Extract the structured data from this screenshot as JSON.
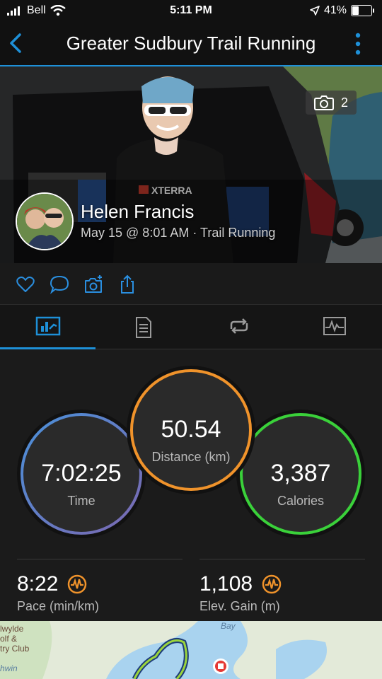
{
  "status_bar": {
    "carrier": "Bell",
    "time": "5:11 PM",
    "battery_percent": "41%",
    "battery_level": 0.41
  },
  "nav": {
    "title": "Greater Sudbury Trail Running"
  },
  "hero": {
    "photo_count": "2",
    "athlete_name": "Helen Francis",
    "activity_meta": "May 15 @ 8:01 AM · Trail Running",
    "shirt_text": "XTERRA"
  },
  "actions": [
    {
      "name": "like",
      "icon": "heart-icon"
    },
    {
      "name": "comment",
      "icon": "comment-icon"
    },
    {
      "name": "add-photo",
      "icon": "camera-plus-icon"
    },
    {
      "name": "share",
      "icon": "share-icon"
    }
  ],
  "tabs": [
    {
      "name": "summary",
      "icon": "summary-chart-icon",
      "active": true
    },
    {
      "name": "details",
      "icon": "document-icon",
      "active": false
    },
    {
      "name": "laps",
      "icon": "laps-icon",
      "active": false
    },
    {
      "name": "charts",
      "icon": "graph-icon",
      "active": false
    }
  ],
  "stats": {
    "time": {
      "value": "7:02:25",
      "label": "Time"
    },
    "distance": {
      "value": "50.54",
      "label": "Distance (km)"
    },
    "calories": {
      "value": "3,387",
      "label": "Calories"
    },
    "pace": {
      "value": "8:22",
      "label": "Pace (min/km)"
    },
    "elev_gain": {
      "value": "1,108",
      "label": "Elev. Gain (m)"
    }
  },
  "map": {
    "labels": [
      "lwylde",
      "olf &",
      "try Club",
      "hwin",
      "Bay"
    ]
  },
  "colors": {
    "accent": "#1e90d8",
    "time_ring_start": "#4a90d9",
    "time_ring_end": "#7b68b0",
    "distance_ring": "#f0932b",
    "calories_ring": "#3ad13a",
    "badge": "#f0932b"
  }
}
